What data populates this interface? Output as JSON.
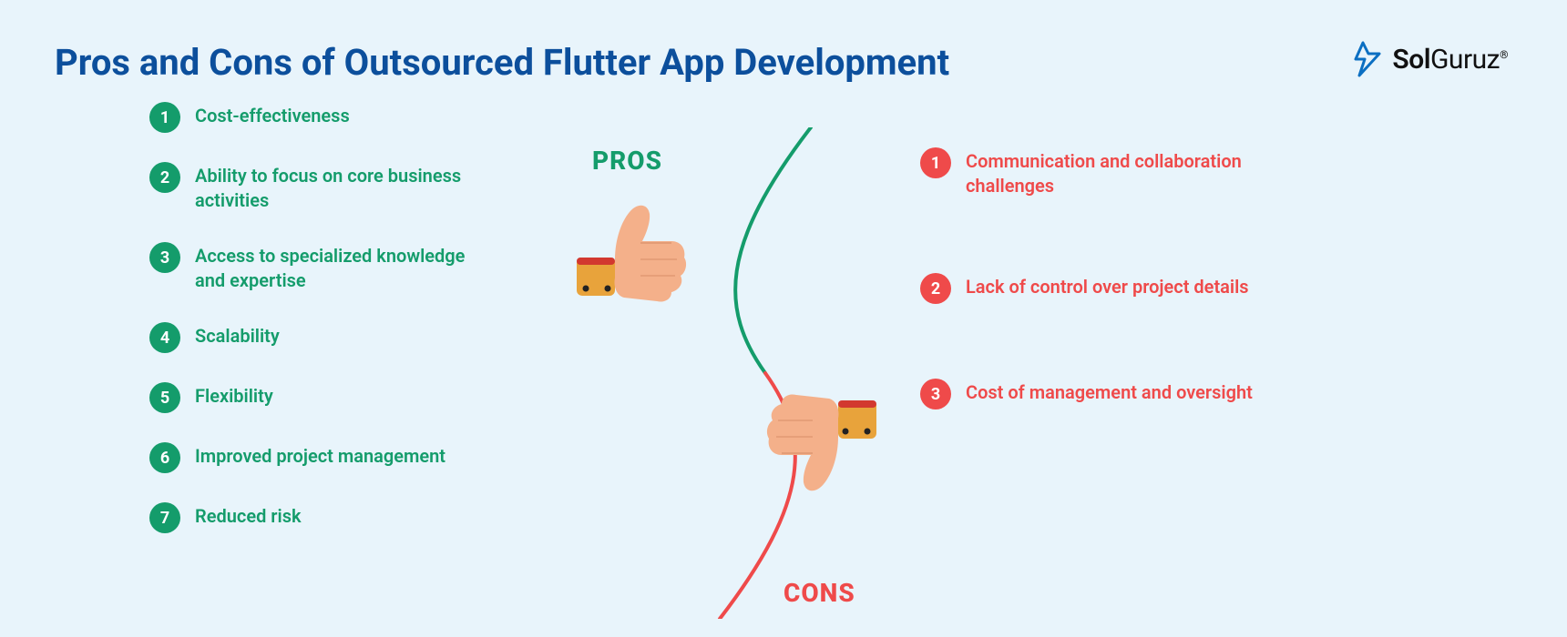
{
  "title": "Pros and Cons of Outsourced Flutter App Development",
  "brand": {
    "name1": "Sol",
    "name2": "Guruz",
    "reg": "®"
  },
  "labels": {
    "pros": "PROS",
    "cons": "CONS"
  },
  "pros": [
    {
      "num": "1",
      "text": "Cost-effectiveness"
    },
    {
      "num": "2",
      "text": "Ability to focus on core business activities"
    },
    {
      "num": "3",
      "text": "Access to specialized knowledge and expertise"
    },
    {
      "num": "4",
      "text": "Scalability"
    },
    {
      "num": "5",
      "text": "Flexibility"
    },
    {
      "num": "6",
      "text": "Improved project management"
    },
    {
      "num": "7",
      "text": "Reduced risk"
    }
  ],
  "cons": [
    {
      "num": "1",
      "text": "Communication and collaboration challenges"
    },
    {
      "num": "2",
      "text": "Lack of control over project details"
    },
    {
      "num": "3",
      "text": "Cost of management and oversight"
    }
  ],
  "colors": {
    "green": "#149c6b",
    "red": "#ef4a4a",
    "title": "#0c4f9c"
  }
}
